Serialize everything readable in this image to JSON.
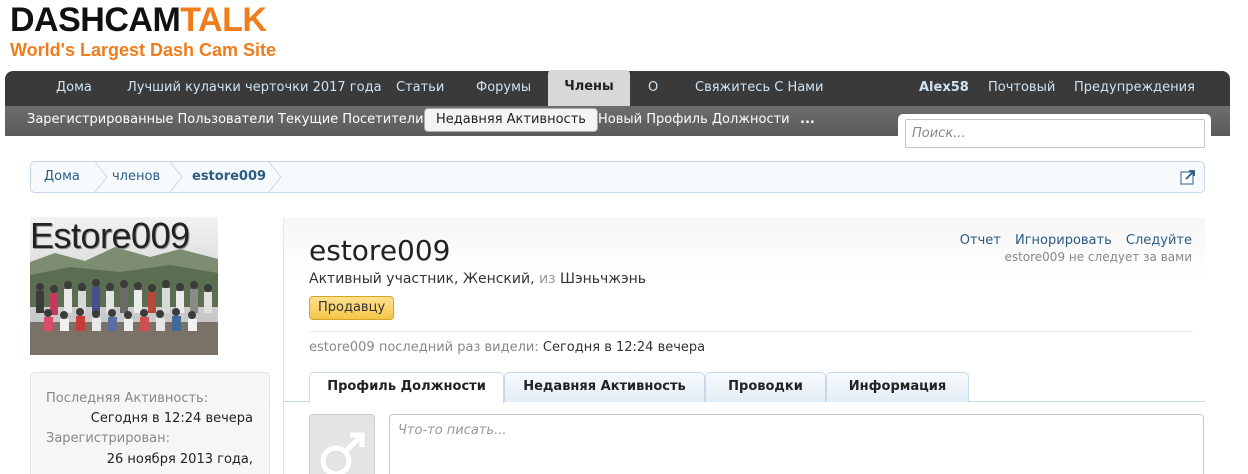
{
  "logo": {
    "part1": "DASHCAM",
    "part2": "TALK",
    "tagline": "World's Largest Dash Cam Site"
  },
  "nav": {
    "items": [
      {
        "label": "Дома"
      },
      {
        "label": "Лучший кулачки черточки 2017 года"
      },
      {
        "label": "Статьи"
      },
      {
        "label": "Форумы"
      },
      {
        "label": "Члены"
      },
      {
        "label": "О"
      },
      {
        "label": "Свяжитесь С Нами"
      }
    ],
    "user": "Alex58",
    "inbox": "Почтовый",
    "alerts": "Предупреждения"
  },
  "subnav": {
    "items": [
      {
        "label": "Зарегистрированные Пользователи"
      },
      {
        "label": "Текущие Посетители"
      },
      {
        "label": "Недавняя Активность"
      },
      {
        "label": "Новый Профиль Должности"
      },
      {
        "label": "..."
      }
    ]
  },
  "search": {
    "placeholder": "Поиск..."
  },
  "breadcrumb": {
    "items": [
      "Дома",
      "членов",
      "estore009"
    ]
  },
  "avatar": {
    "name_text": "Estore009"
  },
  "info": {
    "last_activity_label": "Последняя Активность:",
    "last_activity_value": "Сегодня в 12:24 вечера",
    "registered_label": "Зарегистрирован:",
    "registered_value": "26 ноября 2013 года,"
  },
  "profile": {
    "username": "estore009",
    "title_part1": "Активный участник, Женский,",
    "title_from": "из",
    "title_location": "Шэньчжэнь",
    "badge": "Продавцу",
    "last_seen_label": "estore009 последний раз видели:",
    "last_seen_value": "Сегодня в 12:24 вечера",
    "actions": {
      "report": "Отчет",
      "ignore": "Игнорировать",
      "follow": "Следуйте"
    },
    "follow_note": "estore009 не следует за вами"
  },
  "tabs": [
    {
      "label": "Профиль Должности"
    },
    {
      "label": "Недавняя Активность"
    },
    {
      "label": "Проводки"
    },
    {
      "label": "Информация"
    }
  ],
  "post": {
    "placeholder": "Что-то писать..."
  },
  "colors": {
    "accent": "#f07c1b",
    "nav_bg": "#3a3a3a",
    "link": "#2a5b84"
  }
}
